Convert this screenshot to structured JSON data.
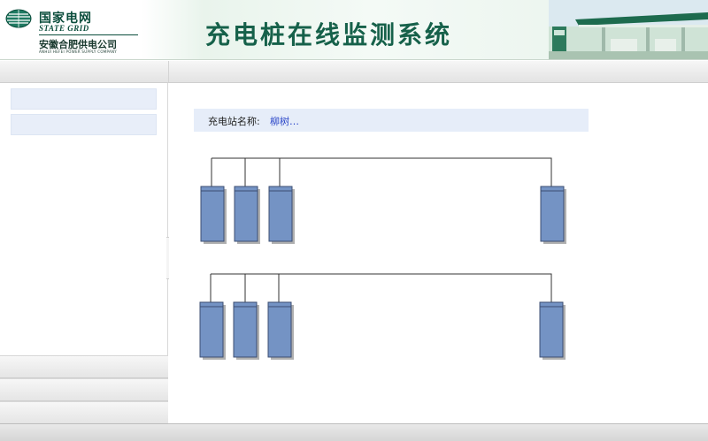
{
  "header": {
    "logo_cn": "国家电网",
    "logo_en": "STATE GRID",
    "company_cn": "安徽合肥供电公司",
    "company_en": "ANHUI HEFEI POWER SUPPLY COMPANY",
    "system_title": "充电桩在线监测系统"
  },
  "station": {
    "label": "充电站名称:",
    "value": "柳树…"
  },
  "colors": {
    "accent_green": "#16614a",
    "charger_fill": "#7493c4",
    "charger_border": "#3b4e72",
    "sidebar_item": "#e8eef9",
    "station_bar": "#e6edf9"
  },
  "icons": {
    "logo": "state-grid-globe-icon",
    "collapse": "chevron-left-icon"
  }
}
